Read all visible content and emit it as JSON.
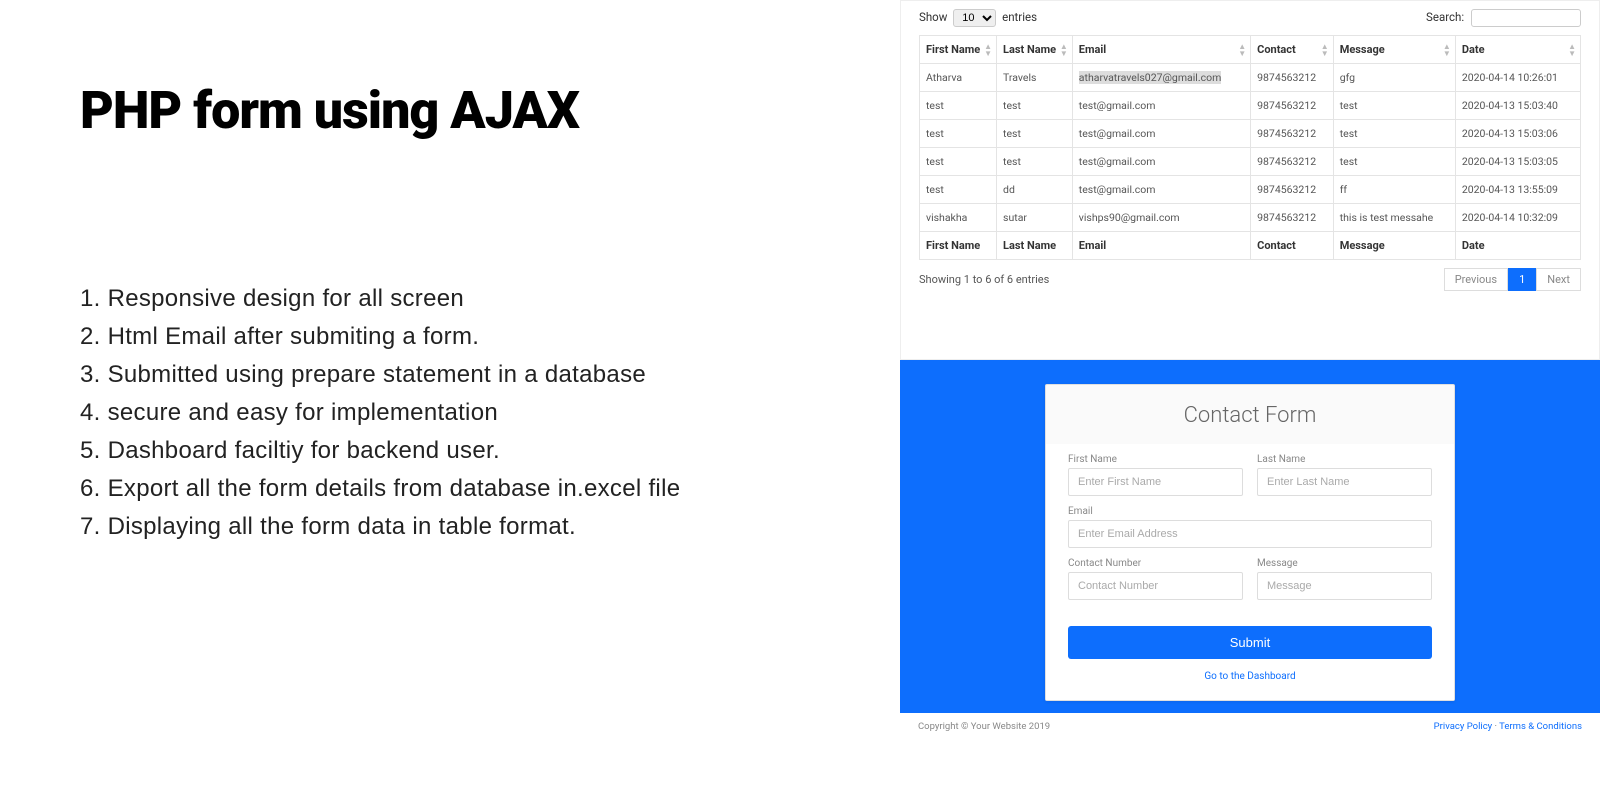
{
  "left": {
    "title": "PHP form using AJAX",
    "features": [
      "1. Responsive design for all screen",
      "2. Html Email after submiting a form.",
      "3. Submitted using prepare statement in a database",
      "4. secure and easy for implementation",
      "5. Dashboard faciltiy for backend user.",
      "6. Export all the form details from database in.excel file",
      "7. Displaying all the form data in table format."
    ]
  },
  "table": {
    "show_label_pre": "Show",
    "show_value": "10",
    "show_label_post": "entries",
    "search_label": "Search:",
    "columns": [
      "First Name",
      "Last Name",
      "Email",
      "Contact",
      "Message",
      "Date"
    ],
    "rows": [
      {
        "first": "Atharva",
        "last": "Travels",
        "email": "atharvatravels027@gmail.com",
        "contact": "9874563212",
        "message": "gfg",
        "date": "2020-04-14 10:26:01"
      },
      {
        "first": "test",
        "last": "test",
        "email": "test@gmail.com",
        "contact": "9874563212",
        "message": "test",
        "date": "2020-04-13 15:03:40"
      },
      {
        "first": "test",
        "last": "test",
        "email": "test@gmail.com",
        "contact": "9874563212",
        "message": "test",
        "date": "2020-04-13 15:03:06"
      },
      {
        "first": "test",
        "last": "test",
        "email": "test@gmail.com",
        "contact": "9874563212",
        "message": "test",
        "date": "2020-04-13 15:03:05"
      },
      {
        "first": "test",
        "last": "dd",
        "email": "test@gmail.com",
        "contact": "9874563212",
        "message": "ff",
        "date": "2020-04-13 13:55:09"
      },
      {
        "first": "vishakha",
        "last": "sutar",
        "email": "vishps90@gmail.com",
        "contact": "9874563212",
        "message": "this is test messahe",
        "date": "2020-04-14 10:32:09"
      }
    ],
    "info": "Showing 1 to 6 of 6 entries",
    "prev": "Previous",
    "page": "1",
    "next": "Next"
  },
  "form": {
    "title": "Contact Form",
    "first_label": "First Name",
    "first_ph": "Enter First Name",
    "last_label": "Last Name",
    "last_ph": "Enter Last Name",
    "email_label": "Email",
    "email_ph": "Enter Email Address",
    "contact_label": "Contact Number",
    "contact_ph": "Contact Number",
    "message_label": "Message",
    "message_ph": "Message",
    "submit": "Submit",
    "dash_link": "Go to the Dashboard"
  },
  "footer": {
    "copyright": "Copyright © Your Website 2019",
    "privacy": "Privacy Policy",
    "sep": " · ",
    "terms": "Terms & Conditions"
  }
}
